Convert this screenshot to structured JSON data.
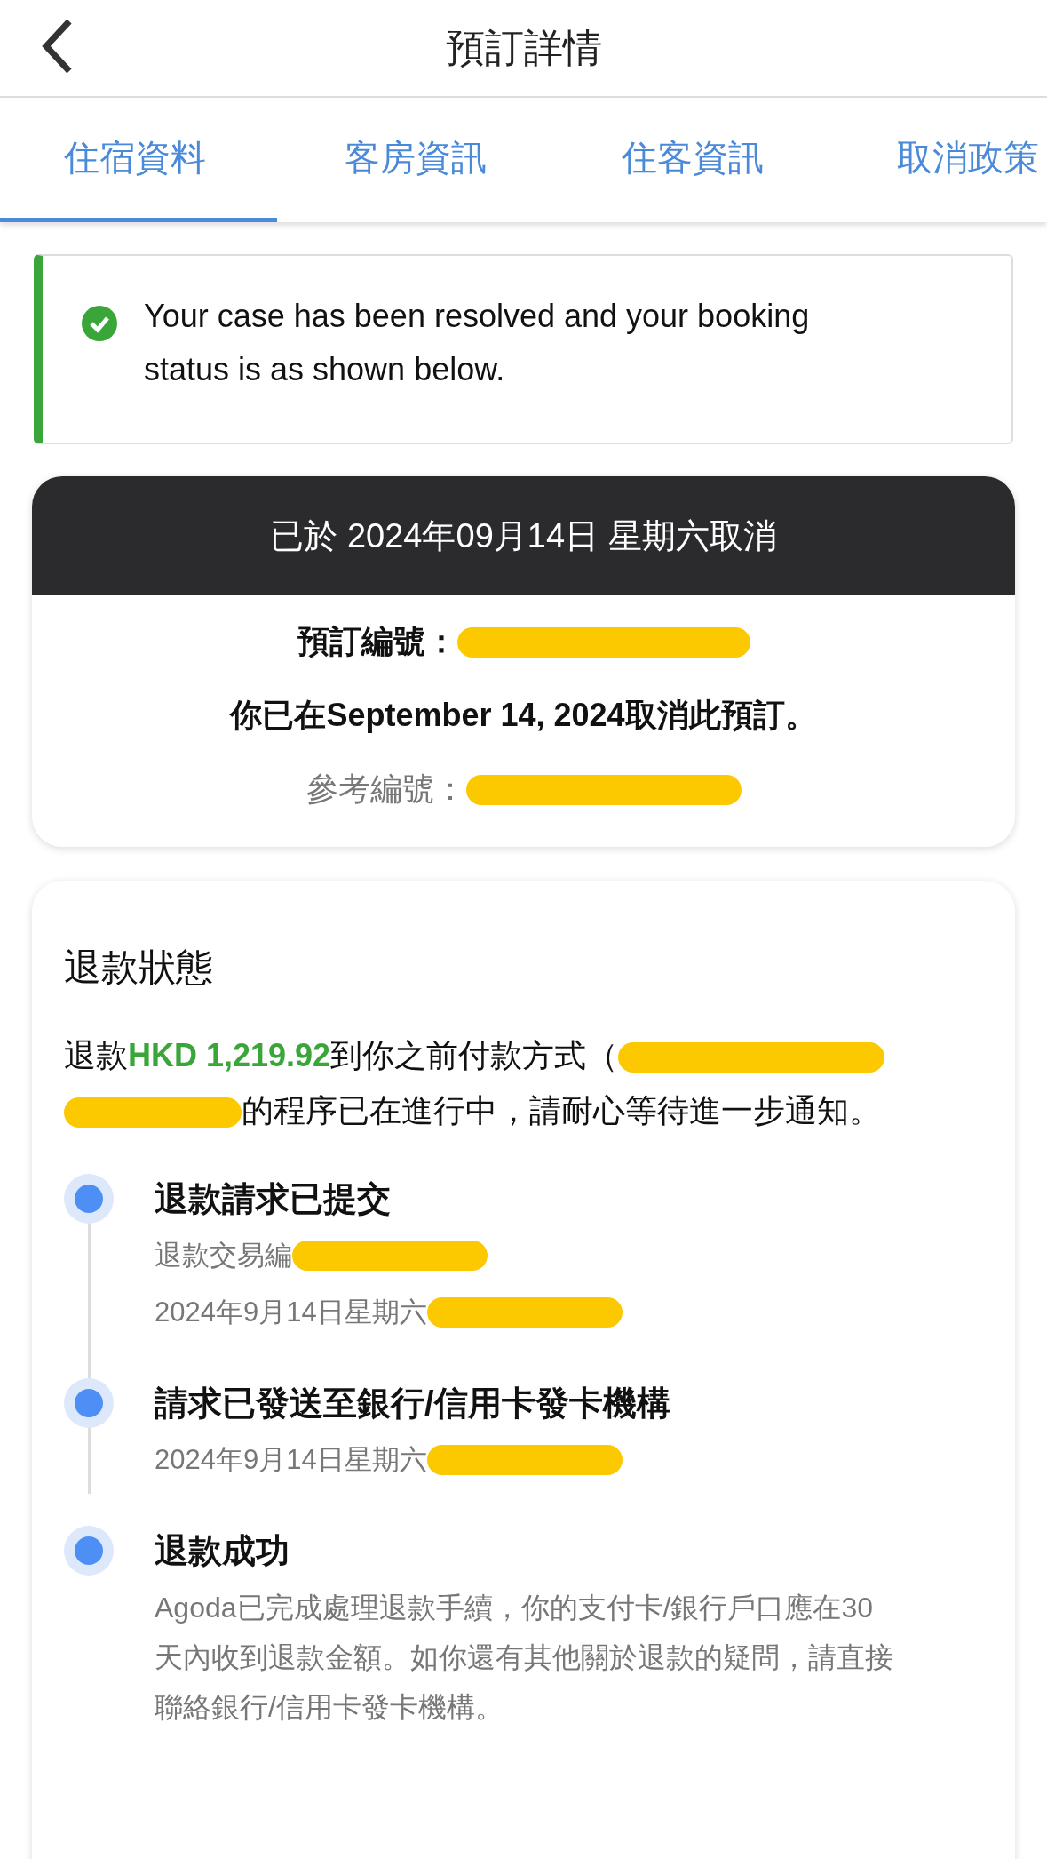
{
  "header": {
    "title": "預訂詳情"
  },
  "tabs": [
    {
      "label": "住宿資料",
      "selected": true
    },
    {
      "label": "客房資訊",
      "selected": false
    },
    {
      "label": "住客資訊",
      "selected": false
    },
    {
      "label": "取消政策",
      "selected": false
    }
  ],
  "notice": {
    "text": "Your case has been resolved and your booking status is as shown below."
  },
  "cancellation": {
    "banner": "已於 2024年09月14日 星期六取消",
    "booking_id_label": "預訂編號：",
    "booking_id_redacted": true,
    "message": "你已在September 14, 2024取消此預訂。",
    "reference_label": "參考編號：",
    "reference_redacted": true
  },
  "refund": {
    "title": "退款狀態",
    "text_before": "退款",
    "amount": "HKD 1,219.92",
    "text_after": "到你之前付款方式（",
    "redacted": true,
    "text_line2": "的程序已在進行中，請耐心等待進一步通知。",
    "steps": [
      {
        "title": "退款請求已提交",
        "lines": [
          {
            "text": "退款交易編",
            "redacted": true
          },
          {
            "text": "2024年9月14日星期六",
            "redacted": true
          }
        ]
      },
      {
        "title": "請求已發送至銀行/信用卡發卡機構",
        "lines": [
          {
            "text": "2024年9月14日星期六",
            "redacted": true
          }
        ]
      },
      {
        "title": "退款成功",
        "lines": [
          {
            "text": "Agoda已完成處理退款手續，你的支付卡/銀行戶口應在30天內收到退款金額。如你還有其他關於退款的疑問，請直接聯絡銀行/信用卡發卡機構。",
            "redacted": false
          }
        ]
      }
    ]
  }
}
